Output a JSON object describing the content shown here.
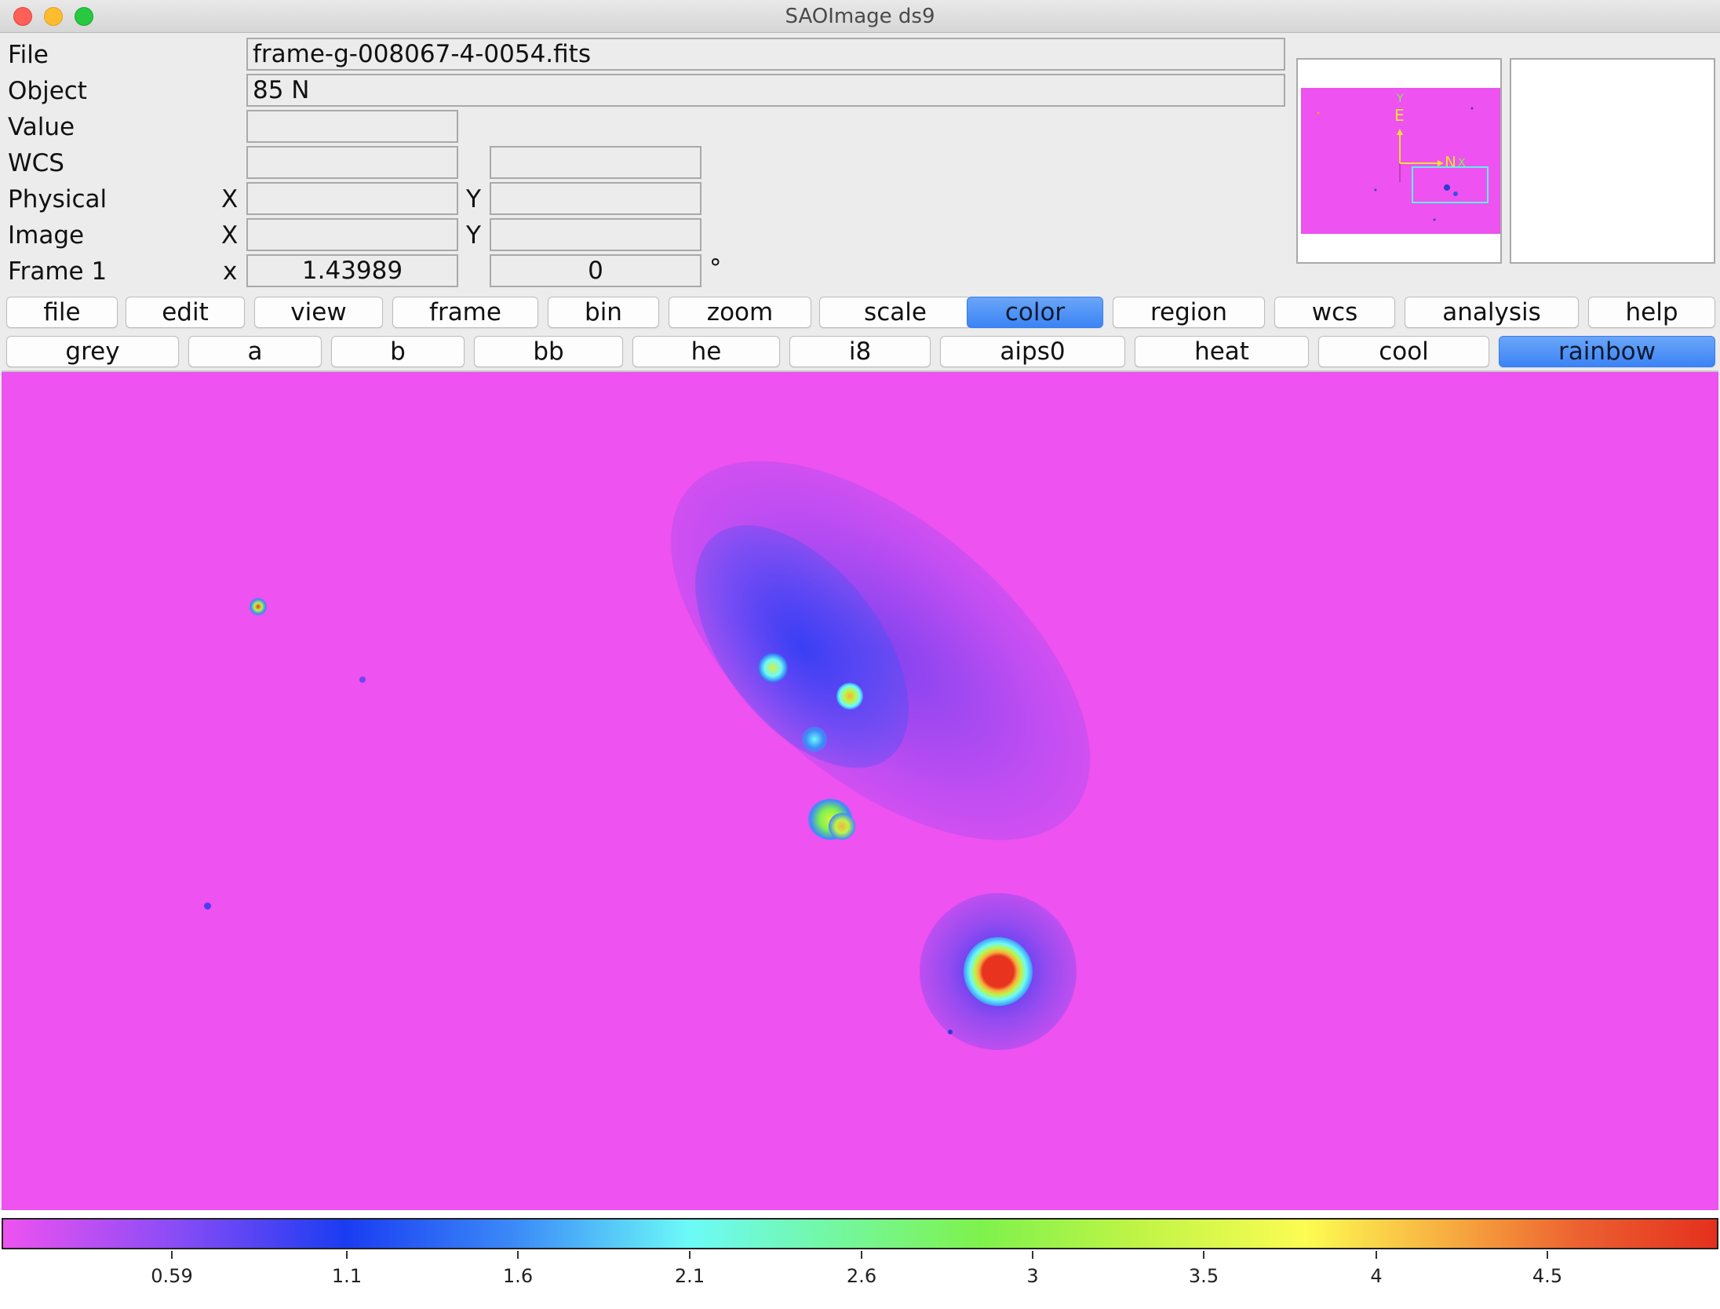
{
  "window": {
    "title": "SAOImage ds9"
  },
  "info": {
    "labels": {
      "file": "File",
      "object": "Object",
      "value": "Value",
      "wcs": "WCS",
      "physical": "Physical",
      "image": "Image",
      "frame": "Frame 1"
    },
    "axis": {
      "x_upper": "X",
      "y_upper": "Y",
      "x_lower": "x",
      "degree": "°"
    },
    "file_value": "frame-g-008067-4-0054.fits",
    "object_value": "85 N",
    "value_value": "",
    "wcs_x": "",
    "wcs_y": "",
    "physical_x": "",
    "physical_y": "",
    "image_x": "",
    "image_y": "",
    "frame_zoom": "1.43989",
    "frame_angle": "0"
  },
  "panner": {
    "compass_north": "N",
    "compass_east": "E",
    "axis_x": "X",
    "axis_y": "Y"
  },
  "menu": {
    "items": [
      "file",
      "edit",
      "view",
      "frame",
      "bin",
      "zoom",
      "scale",
      "color",
      "region",
      "wcs",
      "analysis",
      "help"
    ],
    "active": "color"
  },
  "colormaps": {
    "items": [
      "grey",
      "a",
      "b",
      "bb",
      "he",
      "i8",
      "aips0",
      "heat",
      "cool",
      "rainbow"
    ],
    "active": "rainbow"
  },
  "colorbar": {
    "ticks": [
      "0.59",
      "1.1",
      "1.6",
      "2.1",
      "2.6",
      "3",
      "3.5",
      "4",
      "4.5"
    ]
  },
  "colors": {
    "background": "#ee52f0",
    "active_button": "#3b84f5",
    "core_red": "#e8341e"
  }
}
